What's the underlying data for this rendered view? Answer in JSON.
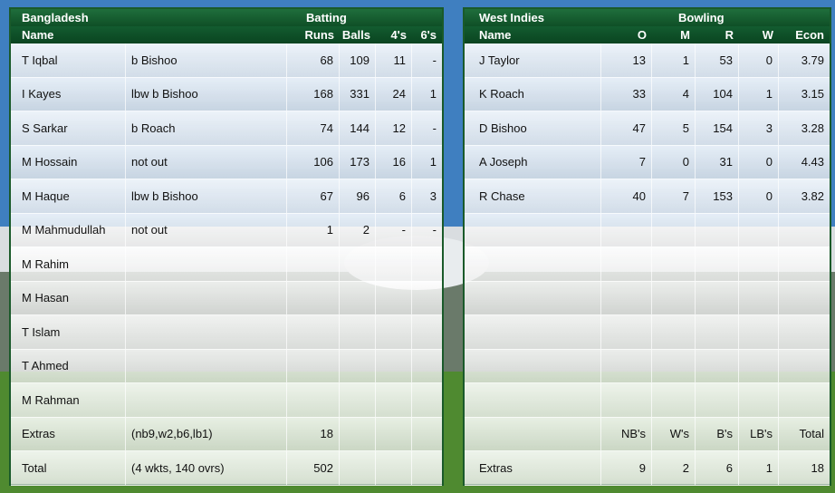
{
  "batting": {
    "team": "Bangladesh",
    "title": "Batting",
    "headers": {
      "name": "Name",
      "runs": "Runs",
      "balls": "Balls",
      "fours": "4's",
      "sixes": "6's"
    },
    "rows": [
      {
        "name": "T Iqbal",
        "how": "b Bishoo",
        "runs": "68",
        "balls": "109",
        "fours": "11",
        "sixes": "-"
      },
      {
        "name": "I Kayes",
        "how": "lbw b Bishoo",
        "runs": "168",
        "balls": "331",
        "fours": "24",
        "sixes": "1"
      },
      {
        "name": "S Sarkar",
        "how": "b Roach",
        "runs": "74",
        "balls": "144",
        "fours": "12",
        "sixes": "-"
      },
      {
        "name": "M Hossain",
        "how": "not out",
        "runs": "106",
        "balls": "173",
        "fours": "16",
        "sixes": "1"
      },
      {
        "name": "M Haque",
        "how": "lbw b Bishoo",
        "runs": "67",
        "balls": "96",
        "fours": "6",
        "sixes": "3"
      },
      {
        "name": "M Mahmudullah",
        "how": "not out",
        "runs": "1",
        "balls": "2",
        "fours": "-",
        "sixes": "-"
      },
      {
        "name": "M Rahim",
        "how": "",
        "runs": "",
        "balls": "",
        "fours": "",
        "sixes": ""
      },
      {
        "name": "M Hasan",
        "how": "",
        "runs": "",
        "balls": "",
        "fours": "",
        "sixes": ""
      },
      {
        "name": "T Islam",
        "how": "",
        "runs": "",
        "balls": "",
        "fours": "",
        "sixes": ""
      },
      {
        "name": "T Ahmed",
        "how": "",
        "runs": "",
        "balls": "",
        "fours": "",
        "sixes": ""
      },
      {
        "name": "M Rahman",
        "how": "",
        "runs": "",
        "balls": "",
        "fours": "",
        "sixes": ""
      },
      {
        "name": "Extras",
        "how": "(nb9,w2,b6,lb1)",
        "runs": "18",
        "balls": "",
        "fours": "",
        "sixes": ""
      },
      {
        "name": "Total",
        "how": "(4 wkts, 140 ovrs)",
        "runs": "502",
        "balls": "",
        "fours": "",
        "sixes": ""
      }
    ]
  },
  "bowling": {
    "team": "West Indies",
    "title": "Bowling",
    "headers": {
      "name": "Name",
      "o": "O",
      "m": "M",
      "r": "R",
      "w": "W",
      "econ": "Econ"
    },
    "rows": [
      {
        "name": "J Taylor",
        "o": "13",
        "m": "1",
        "r": "53",
        "w": "0",
        "econ": "3.79"
      },
      {
        "name": "K Roach",
        "o": "33",
        "m": "4",
        "r": "104",
        "w": "1",
        "econ": "3.15"
      },
      {
        "name": "D Bishoo",
        "o": "47",
        "m": "5",
        "r": "154",
        "w": "3",
        "econ": "3.28"
      },
      {
        "name": "A Joseph",
        "o": "7",
        "m": "0",
        "r": "31",
        "w": "0",
        "econ": "4.43"
      },
      {
        "name": "R Chase",
        "o": "40",
        "m": "7",
        "r": "153",
        "w": "0",
        "econ": "3.82"
      },
      {
        "name": "",
        "o": "",
        "m": "",
        "r": "",
        "w": "",
        "econ": ""
      },
      {
        "name": "",
        "o": "",
        "m": "",
        "r": "",
        "w": "",
        "econ": ""
      },
      {
        "name": "",
        "o": "",
        "m": "",
        "r": "",
        "w": "",
        "econ": ""
      },
      {
        "name": "",
        "o": "",
        "m": "",
        "r": "",
        "w": "",
        "econ": ""
      },
      {
        "name": "",
        "o": "",
        "m": "",
        "r": "",
        "w": "",
        "econ": ""
      },
      {
        "name": "",
        "o": "",
        "m": "",
        "r": "",
        "w": "",
        "econ": ""
      },
      {
        "name": "",
        "o": "NB's",
        "m": "W's",
        "r": "B's",
        "w": "LB's",
        "econ": "Total"
      },
      {
        "name": "Extras",
        "o": "9",
        "m": "2",
        "r": "6",
        "w": "1",
        "econ": "18"
      }
    ]
  },
  "colors": {
    "header_green": "#0f4f26",
    "border_green": "#1a5a2a"
  }
}
